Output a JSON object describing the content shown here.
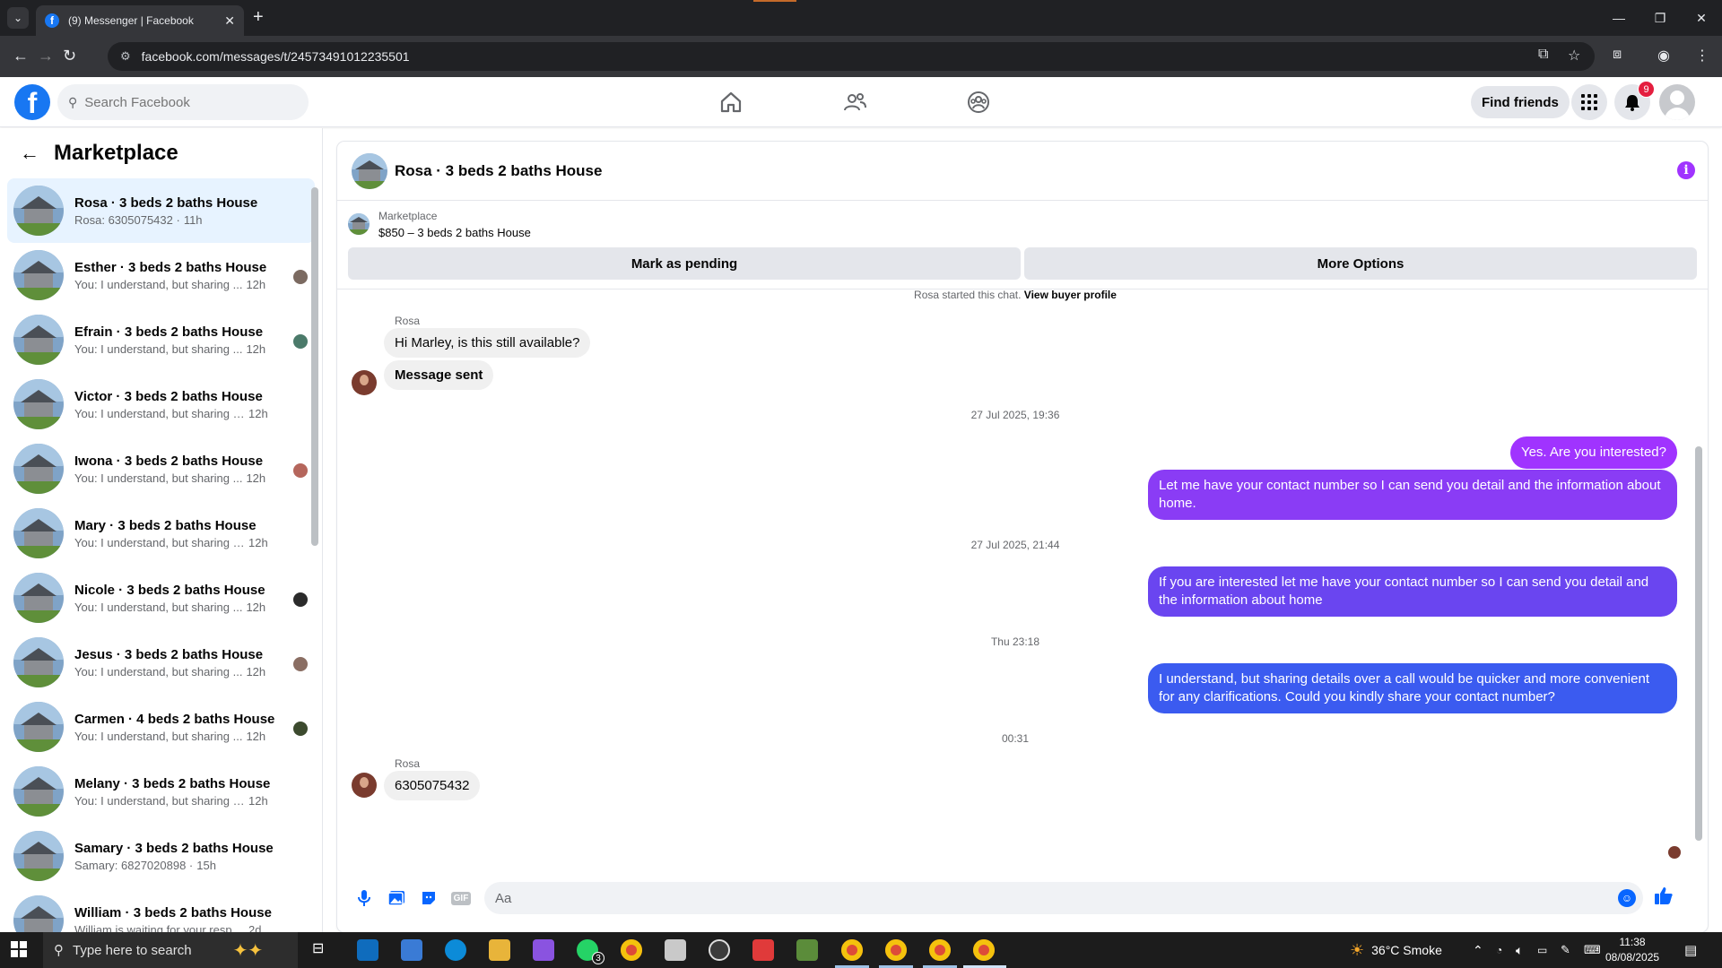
{
  "browser": {
    "tab_title": "(9) Messenger | Facebook",
    "url": "facebook.com/messages/t/24573491012235501",
    "favicon": "facebook-icon"
  },
  "header": {
    "search_placeholder": "Search Facebook",
    "find_friends_label": "Find friends",
    "notification_count": "9"
  },
  "sidebar": {
    "title": "Marketplace",
    "conversations": [
      {
        "name": "Rosa · 3 beds 2 baths House",
        "snippet": "Rosa: 6305075432 ·",
        "time": "11h",
        "active": true
      },
      {
        "name": "Esther · 3 beds 2 baths House",
        "snippet": "You: I understand, but sharing ...",
        "time": "12h"
      },
      {
        "name": "Efrain · 3 beds 2 baths House",
        "snippet": "You: I understand, but sharing ...",
        "time": "12h"
      },
      {
        "name": "Victor · 3 beds 2 baths House",
        "snippet": "You: I understand, but sharing det...",
        "time": "12h"
      },
      {
        "name": "Iwona · 3 beds 2 baths House",
        "snippet": "You: I understand, but sharing ...",
        "time": "12h"
      },
      {
        "name": "Mary · 3 beds 2 baths House",
        "snippet": "You: I understand, but sharing det...",
        "time": "12h"
      },
      {
        "name": "Nicole · 3 beds 2 baths House",
        "snippet": "You: I understand, but sharing ...",
        "time": "12h"
      },
      {
        "name": "Jesus · 3 beds 2 baths House",
        "snippet": "You: I understand, but sharing ...",
        "time": "12h"
      },
      {
        "name": "Carmen · 4 beds 2 baths House",
        "snippet": "You: I understand, but sharing ...",
        "time": "12h"
      },
      {
        "name": "Melany · 3 beds 2 baths House",
        "snippet": "You: I understand, but sharing det...",
        "time": "12h"
      },
      {
        "name": "Samary · 3 beds 2 baths House",
        "snippet": "Samary: 6827020898 ·",
        "time": "15h"
      },
      {
        "name": "William · 3 beds 2 baths House",
        "snippet": "William is waiting for your respons... ·",
        "time": "2d"
      }
    ]
  },
  "chat": {
    "title": "Rosa · 3 beds 2 baths House",
    "listing_label": "Marketplace",
    "listing_title": "$850 – 3 beds 2 baths House",
    "mark_pending_label": "Mark as pending",
    "more_options_label": "More Options",
    "started_text": "Rosa started this chat.",
    "view_buyer_label": "View buyer profile",
    "sender_name": "Rosa",
    "incoming_1": "Hi Marley, is this still available?",
    "incoming_2": "Message sent",
    "ts_1": "27 Jul 2025, 19:36",
    "out_1": "Yes. Are you interested?",
    "out_2": "Let me have your contact number so I can send you detail and the information about home.",
    "ts_2": "27 Jul 2025, 21:44",
    "out_3": "If  you are interested let me have your contact number so I can send you detail and the information about home",
    "ts_3": "Thu 23:18",
    "out_4": "I understand, but sharing details over a call would be quicker and more convenient for any clarifications. Could you kindly share your contact number?",
    "ts_4": "00:31",
    "incoming_3": "6305075432",
    "composer_placeholder": "Aa",
    "gif_label": "GIF",
    "bubble_colors": [
      "#a033ff",
      "#8a3cf5",
      "#6a45f0",
      "#3b5bf0"
    ]
  },
  "taskbar": {
    "search_placeholder": "Type here to search",
    "weather": "36°C  Smoke",
    "time": "11:38",
    "date": "08/08/2025",
    "whatsapp_badge": "3"
  }
}
